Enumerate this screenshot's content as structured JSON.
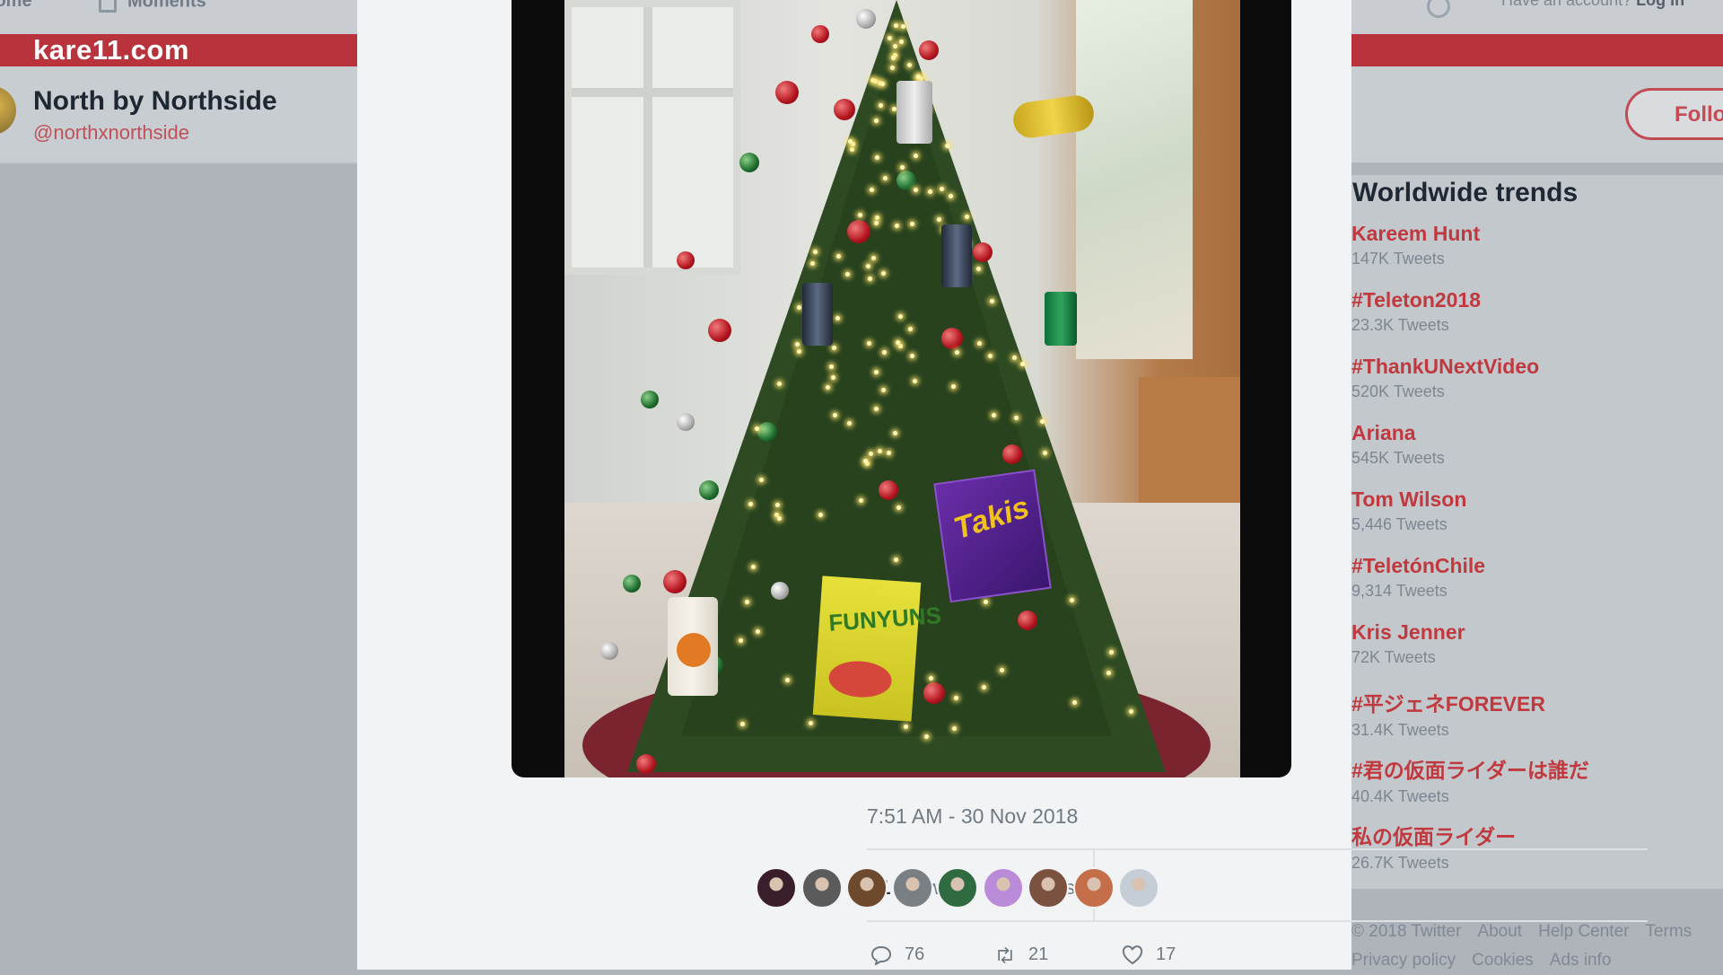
{
  "topnav": {
    "home": "Home",
    "moments": "Moments",
    "account_prompt": "Have an account?",
    "login": "Log in"
  },
  "site": {
    "url": "kare11.com"
  },
  "profile": {
    "name": "North by Northside",
    "handle": "@northxnorthside",
    "follow_label": "Follo"
  },
  "tweet": {
    "timestamp": "7:51 AM - 30 Nov 2018",
    "retweets_count": "21",
    "retweets_label": "Retweets",
    "likes_count": "17",
    "likes_label": "Likes",
    "replies_action": "76",
    "retweets_action": "21",
    "likes_action": "17",
    "photo": {
      "snack_takis": "Takis",
      "snack_funyuns": "FUNYUNS"
    },
    "liker_colors": [
      "#3a1e2c",
      "#5b5b5b",
      "#6d4a2e",
      "#7a7f84",
      "#2f6a40",
      "#b98bd9",
      "#7b5140",
      "#c46e4a",
      "#c5ced6"
    ]
  },
  "trends": {
    "title": "Worldwide trends",
    "items": [
      {
        "name": "Kareem Hunt",
        "count": "147K Tweets"
      },
      {
        "name": "#Teleton2018",
        "count": "23.3K Tweets"
      },
      {
        "name": "#ThankUNextVideo",
        "count": "520K Tweets"
      },
      {
        "name": "Ariana",
        "count": "545K Tweets"
      },
      {
        "name": "Tom Wilson",
        "count": "5,446 Tweets"
      },
      {
        "name": "#TeletónChile",
        "count": "9,314 Tweets"
      },
      {
        "name": "Kris Jenner",
        "count": "72K Tweets"
      },
      {
        "name": "#平ジェネFOREVER",
        "count": "31.4K Tweets"
      },
      {
        "name": "#君の仮面ライダーは誰だ",
        "count": "40.4K Tweets"
      },
      {
        "name": "私の仮面ライダー",
        "count": "26.7K Tweets"
      }
    ]
  },
  "footer": {
    "row1": [
      "© 2018 Twitter",
      "About",
      "Help Center",
      "Terms"
    ],
    "row2": [
      "Privacy policy",
      "Cookies",
      "Ads info"
    ]
  },
  "colors": {
    "brand_red": "#b8333b",
    "link_red": "#c0393f",
    "text_dark": "#1e2833",
    "muted": "#6f7a83"
  }
}
